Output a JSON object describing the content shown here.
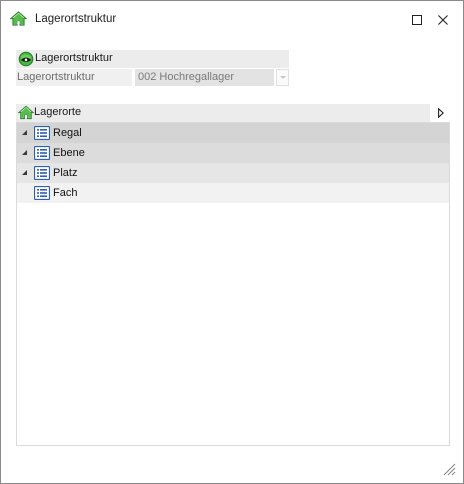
{
  "window": {
    "title": "Lagerortstruktur",
    "maximize_label": "maximize",
    "close_label": "close"
  },
  "structure_group": {
    "header": "Lagerortstruktur",
    "field_label": "Lagerortstruktur",
    "field_value": "002 Hochregallager"
  },
  "locations_group": {
    "header": "Lagerorte",
    "tree": [
      {
        "label": "Regal",
        "expanded": true,
        "bg": "#d4d4d4"
      },
      {
        "label": "Ebene",
        "expanded": true,
        "bg": "#dcdcdc"
      },
      {
        "label": "Platz",
        "expanded": true,
        "bg": "#e6e6e6"
      },
      {
        "label": "Fach",
        "expanded": false,
        "bg": "#f2f2f2"
      }
    ]
  },
  "colors": {
    "home_icon": "#3aa43a",
    "list_icon": "#2f5fb0",
    "eye_icon": "#2e9e2e"
  }
}
